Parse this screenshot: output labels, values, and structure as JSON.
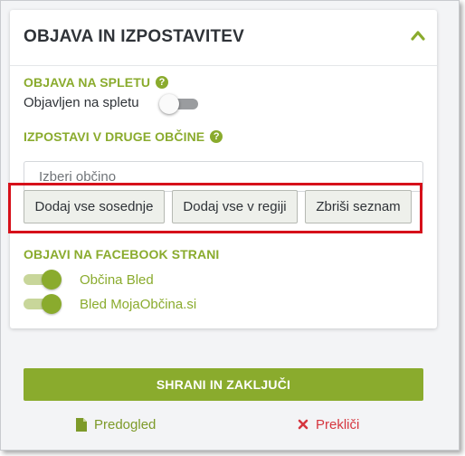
{
  "card": {
    "title": "OBJAVA IN IZPOSTAVITEV",
    "collapse_icon": "chevron-up-icon"
  },
  "web_publish": {
    "section_title": "OBJAVA NA SPLETU",
    "help_icon": "question-circle-icon",
    "toggle_label": "Objavljen na spletu",
    "toggle_state": "off"
  },
  "expose": {
    "section_title": "IZPOSTAVI V DRUGE OBČINE",
    "help_icon": "question-circle-icon",
    "input_value": "",
    "input_placeholder": "Izberi občino",
    "buttons": {
      "add_neighbors": "Dodaj vse sosednje",
      "add_region": "Dodaj vse v regiji",
      "clear_list": "Zbriši seznam"
    }
  },
  "facebook": {
    "section_title": "OBJAVI NA FACEBOOK STRANI",
    "pages": [
      {
        "label": "Občina Bled",
        "state": "on"
      },
      {
        "label": "Bled MojaObčina.si",
        "state": "on"
      }
    ]
  },
  "footer": {
    "save_label": "SHRANI IN ZAKLJUČI",
    "preview_label": "Predogled",
    "preview_icon": "file-icon",
    "cancel_label": "Prekliči",
    "cancel_icon": "close-icon"
  },
  "colors": {
    "accent_green": "#8aab2d",
    "highlight_red": "#d6101a",
    "cancel_red": "#d6363f",
    "title_text": "#2f3338"
  }
}
